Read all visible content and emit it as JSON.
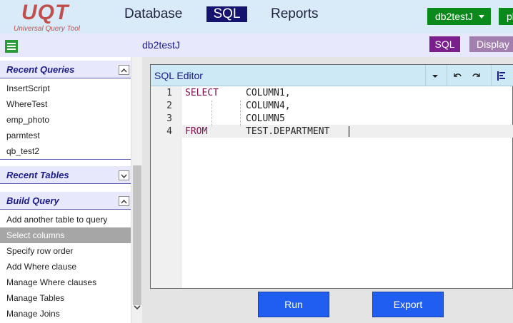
{
  "app": {
    "logo_title": "UQT",
    "logo_subtitle": "Universal Query Tool"
  },
  "nav": {
    "database": "Database",
    "sql": "SQL",
    "reports": "Reports",
    "active": "SQL"
  },
  "topright": {
    "connection": "db2testJ",
    "user_partial": "pl"
  },
  "sidebar": {
    "recent_queries": {
      "title": "Recent Queries",
      "items": [
        "InsertScript",
        "WhereTest",
        "emp_photo",
        "parmtest",
        "qb_test2"
      ]
    },
    "recent_tables": {
      "title": "Recent Tables"
    },
    "build_query": {
      "title": "Build Query",
      "items": [
        "Add another table to query",
        "Select columns",
        "Specify row order",
        "Add Where clause",
        "Manage Where clauses",
        "Manage Tables",
        "Manage Joins"
      ],
      "selected": "Select columns"
    }
  },
  "main": {
    "database_label": "db2testJ",
    "sql_button": "SQL",
    "display_button": "Display"
  },
  "editor": {
    "title": "SQL Editor",
    "line_numbers": [
      "1",
      "2",
      "3",
      "4"
    ],
    "lines": [
      {
        "kw": "SELECT",
        "rest": "COLUMN1,"
      },
      {
        "kw": "",
        "rest": "COLUMN4,"
      },
      {
        "kw": "",
        "rest": "COLUMN5"
      },
      {
        "kw": "FROM",
        "rest": "TEST.DEPARTMENT"
      }
    ]
  },
  "actions": {
    "run": "Run",
    "export": "Export"
  },
  "colors": {
    "topbar_bg": "#d9ebf9",
    "nav_active_bg": "#14136e",
    "connection_btn": "#0b8a1c",
    "sql_btn": "#7b1f8c",
    "display_btn": "#a37fb0",
    "action_btn": "#1f5ef0",
    "keyword": "#77114d"
  }
}
